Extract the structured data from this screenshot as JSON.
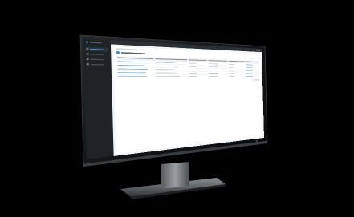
{
  "scene": {
    "subject": "desktop-monitor",
    "background_color": "#000000"
  },
  "app": {
    "sidebar_items": 4,
    "table_rows": 5,
    "table_columns": 6
  },
  "colors": {
    "accent": "#3b8fd8",
    "sidebar": "#1f2326",
    "topbar": "#2a2f33"
  }
}
